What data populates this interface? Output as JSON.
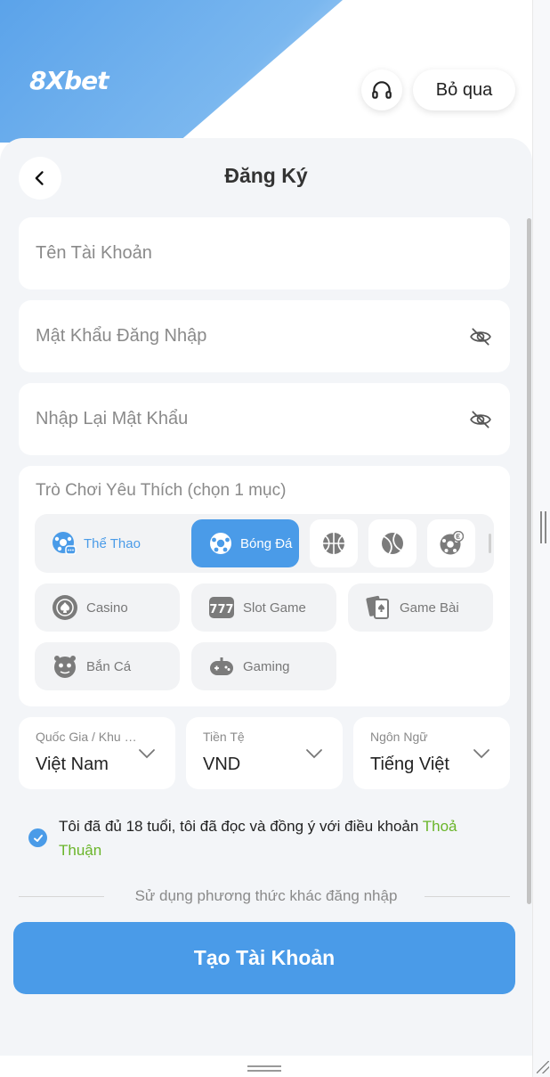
{
  "header": {
    "logo_text": "8Xbet",
    "skip_label": "Bỏ qua",
    "support_icon": "headset-icon"
  },
  "page": {
    "title": "Đăng Ký",
    "back_icon": "chevron-left-icon"
  },
  "form": {
    "username": {
      "placeholder": "Tên Tài Khoản",
      "value": ""
    },
    "password": {
      "placeholder": "Mật Khẩu Đăng Nhập",
      "value": ""
    },
    "confirm_password": {
      "placeholder": "Nhập Lại Mật Khẩu",
      "value": ""
    }
  },
  "games": {
    "title": "Trò Chơi Yêu Thích (chọn 1 mục)",
    "sports": {
      "label": "Thể Thao",
      "selected": "Bóng Đá",
      "options": [
        {
          "label": "Bóng Đá",
          "icon": "soccer-ball-icon"
        },
        {
          "label": "",
          "icon": "basketball-icon"
        },
        {
          "label": "",
          "icon": "tennis-ball-icon"
        },
        {
          "label": "",
          "icon": "esports-ball-icon"
        }
      ]
    },
    "categories": [
      {
        "label": "Casino",
        "icon": "casino-chip-icon"
      },
      {
        "label": "Slot Game",
        "icon": "slot-777-icon"
      },
      {
        "label": "Game Bài",
        "icon": "playing-cards-icon"
      },
      {
        "label": "Bắn Cá",
        "icon": "fish-icon"
      },
      {
        "label": "Gaming",
        "icon": "gamepad-icon"
      }
    ]
  },
  "selects": {
    "country": {
      "label": "Quốc Gia / Khu Vực",
      "value": "Việt Nam"
    },
    "currency": {
      "label": "Tiền Tệ",
      "value": "VND"
    },
    "language": {
      "label": "Ngôn Ngữ",
      "value": "Tiếng Việt"
    }
  },
  "agreement": {
    "checked": true,
    "text": "Tôi đã đủ 18 tuổi, tôi đã đọc và đồng ý với điều khoản ",
    "link_text": "Thoả Thuận"
  },
  "divider_text": "Sử dụng phương thức khác đăng nhập",
  "submit_label": "Tạo Tài Khoản",
  "colors": {
    "primary": "#4a9be8",
    "link_green": "#6ab52a",
    "background": "#f3f5f8"
  }
}
